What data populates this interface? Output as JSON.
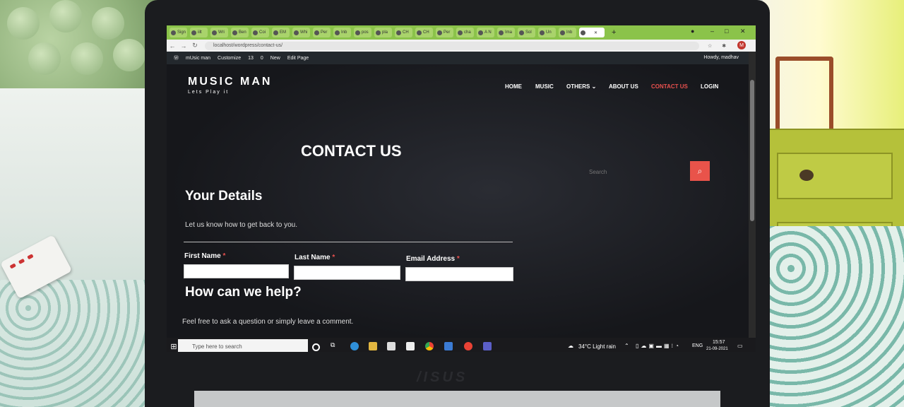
{
  "browser": {
    "tabs": [
      "Sign",
      "iilt",
      "Wri",
      "Ben",
      "Coi",
      "EM",
      "Whi",
      "Per",
      "Inb",
      "pos",
      "pla",
      "CH",
      "CH",
      "Per",
      "cha",
      "A N",
      "Ima",
      "Sol",
      "Un",
      "Inb"
    ],
    "active_tab_index": 20,
    "new_tab": "+",
    "url": "localhost/wordpress/contact-us/",
    "profile_initial": "M"
  },
  "admin_bar": {
    "site": "mUsic man",
    "customize": "Customize",
    "updates": "13",
    "comments": "0",
    "new": "New",
    "edit": "Edit Page",
    "howdy": "Howdy, madhav"
  },
  "site": {
    "logo": "MUSIC MAN",
    "tagline": "Lets Play it",
    "nav": [
      "HOME",
      "MUSIC",
      "OTHERS",
      "ABOUT US",
      "CONTACT US",
      "LOGIN"
    ],
    "nav_active": "CONTACT US",
    "page_title": "CONTACT US",
    "search_placeholder": "Search",
    "section1_title": "Your Details",
    "section1_text": "Let us know how to get back to you.",
    "first_name": "First Name",
    "last_name": "Last Name",
    "email": "Email Address",
    "required_mark": "*",
    "section2_title": "How can we help?",
    "section2_text": "Feel free to ask a question or simply leave a comment."
  },
  "taskbar": {
    "search_placeholder": "Type here to search",
    "weather": "34°C  Light rain",
    "lang": "ENG",
    "time": "15:57",
    "date": "21-09-2021"
  },
  "colors": {
    "accent": "#e8504e",
    "tabbar": "#8bc34a",
    "page_bg": "#16171b"
  }
}
